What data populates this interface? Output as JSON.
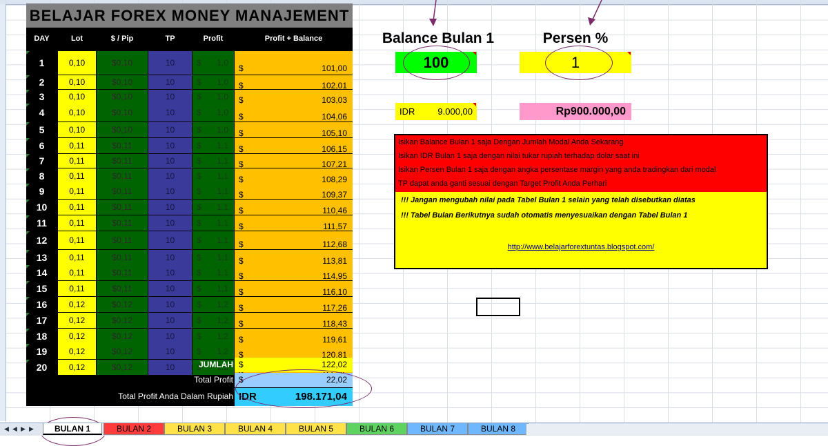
{
  "sheet": {
    "title": "BELAJAR FOREX MONEY MANAJEMENT",
    "headers": [
      "DAY",
      "Lot",
      "$ / Pip",
      "TP",
      "Profit",
      "Profit + Balance"
    ],
    "rows": [
      {
        "day": "1",
        "lot": "0,10",
        "pip": "$0,10",
        "tp": "10",
        "cur": "$",
        "profit": "1,0",
        "bcur": "$",
        "balance": "101,00"
      },
      {
        "day": "2",
        "lot": "0,10",
        "pip": "$0,10",
        "tp": "10",
        "cur": "$",
        "profit": "1,0",
        "bcur": "$",
        "balance": "102,01"
      },
      {
        "day": "3",
        "lot": "0,10",
        "pip": "$0,10",
        "tp": "10",
        "cur": "$",
        "profit": "1,0",
        "bcur": "$",
        "balance": "103,03"
      },
      {
        "day": "4",
        "lot": "0,10",
        "pip": "$0,10",
        "tp": "10",
        "cur": "$",
        "profit": "1,0",
        "bcur": "$",
        "balance": "104,06"
      },
      {
        "day": "5",
        "lot": "0,10",
        "pip": "$0,10",
        "tp": "10",
        "cur": "$",
        "profit": "1,0",
        "bcur": "$",
        "balance": "105,10"
      },
      {
        "day": "6",
        "lot": "0,11",
        "pip": "$0,11",
        "tp": "10",
        "cur": "$",
        "profit": "1,1",
        "bcur": "$",
        "balance": "106,15"
      },
      {
        "day": "7",
        "lot": "0,11",
        "pip": "$0,11",
        "tp": "10",
        "cur": "$",
        "profit": "1,1",
        "bcur": "$",
        "balance": "107,21"
      },
      {
        "day": "8",
        "lot": "0,11",
        "pip": "$0,11",
        "tp": "10",
        "cur": "$",
        "profit": "1,1",
        "bcur": "$",
        "balance": "108,29"
      },
      {
        "day": "9",
        "lot": "0,11",
        "pip": "$0,11",
        "tp": "10",
        "cur": "$",
        "profit": "1,1",
        "bcur": "$",
        "balance": "109,37"
      },
      {
        "day": "10",
        "lot": "0,11",
        "pip": "$0,11",
        "tp": "10",
        "cur": "$",
        "profit": "1,1",
        "bcur": "$",
        "balance": "110,46"
      },
      {
        "day": "11",
        "lot": "0,11",
        "pip": "$0,11",
        "tp": "10",
        "cur": "$",
        "profit": "1,1",
        "bcur": "$",
        "balance": "111,57"
      },
      {
        "day": "12",
        "lot": "0,11",
        "pip": "$0,11",
        "tp": "10",
        "cur": "$",
        "profit": "1,1",
        "bcur": "$",
        "balance": "112,68"
      },
      {
        "day": "13",
        "lot": "0,11",
        "pip": "$0,11",
        "tp": "10",
        "cur": "$",
        "profit": "1,1",
        "bcur": "$",
        "balance": "113,81"
      },
      {
        "day": "14",
        "lot": "0,11",
        "pip": "$0,11",
        "tp": "10",
        "cur": "$",
        "profit": "1,1",
        "bcur": "$",
        "balance": "114,95"
      },
      {
        "day": "15",
        "lot": "0,11",
        "pip": "$0,11",
        "tp": "10",
        "cur": "$",
        "profit": "1,1",
        "bcur": "$",
        "balance": "116,10"
      },
      {
        "day": "16",
        "lot": "0,12",
        "pip": "$0,12",
        "tp": "10",
        "cur": "$",
        "profit": "1,2",
        "bcur": "$",
        "balance": "117,26"
      },
      {
        "day": "17",
        "lot": "0,12",
        "pip": "$0,12",
        "tp": "10",
        "cur": "$",
        "profit": "1,2",
        "bcur": "$",
        "balance": "118,43"
      },
      {
        "day": "18",
        "lot": "0,12",
        "pip": "$0,12",
        "tp": "10",
        "cur": "$",
        "profit": "1,2",
        "bcur": "$",
        "balance": "119,61"
      },
      {
        "day": "19",
        "lot": "0,12",
        "pip": "$0,12",
        "tp": "10",
        "cur": "$",
        "profit": "1,2",
        "bcur": "$",
        "balance": "120,81"
      },
      {
        "day": "20",
        "lot": "0,12",
        "pip": "$0,12",
        "tp": "10",
        "cur": "$",
        "profit": "1,2",
        "bcur": "$",
        "balance": "122,02"
      }
    ],
    "summary": {
      "jumlah_label": "JUMLAH",
      "jumlah_cur": "$",
      "jumlah_value": "122,02",
      "total_profit_label": "Total Profit",
      "total_profit_cur": "$",
      "total_profit_value": "22,02",
      "rupiah_label": "Total Profit Anda Dalam Rupiah",
      "rupiah_cur": "IDR",
      "rupiah_value": "198.171,04"
    }
  },
  "inputs": {
    "balance_label": "Balance Bulan 1",
    "balance_value": "100",
    "persen_label": "Persen %",
    "persen_value": "1",
    "idr_label": "IDR",
    "idr_value": "9.000,00",
    "rp_value": "Rp900.000,00"
  },
  "notes": {
    "red_lines": [
      "Isikan Balance Bulan 1 saja Dengan Jumlah Modal Anda Sekarang",
      "Isikan IDR Bulan 1 saja dengan nilai tukar rupiah terhadap dolar saat ini",
      "Isikan Persen Bulan 1 saja dengan angka persentase margin yang anda tradingkan dari modal",
      "TP dapat anda ganti sesuai dengan Target Profit Anda Perhari"
    ],
    "yellow_lines": [
      "!!! Jangan mengubah nilai pada Tabel Bulan 1 selain yang telah disebutkan diatas",
      "!!! Tabel Bulan Berikutnya sudah otomatis menyesuaikan dengan Tabel Bulan 1"
    ],
    "link": "http://www.belajarforextuntas.blogspot.com/"
  },
  "tabs": [
    {
      "label": "BULAN 1",
      "color": "#ffffff"
    },
    {
      "label": "BULAN 2",
      "color": "#ff3b3b"
    },
    {
      "label": "BULAN 3",
      "color": "#ffe14a"
    },
    {
      "label": "BULAN 4",
      "color": "#ffe14a"
    },
    {
      "label": "BULAN 5",
      "color": "#ffe14a"
    },
    {
      "label": "BULAN 6",
      "color": "#5fd35f"
    },
    {
      "label": "BULAN 7",
      "color": "#6fb7ff"
    },
    {
      "label": "BULAN 8",
      "color": "#6fb7ff"
    }
  ],
  "colors": {
    "accent_oval": "#7b2a6a",
    "balance_bg": "#ffc000",
    "lot_bg": "#ffff00",
    "pip_bg": "#006400",
    "tp_bg": "#3a3a9a"
  }
}
